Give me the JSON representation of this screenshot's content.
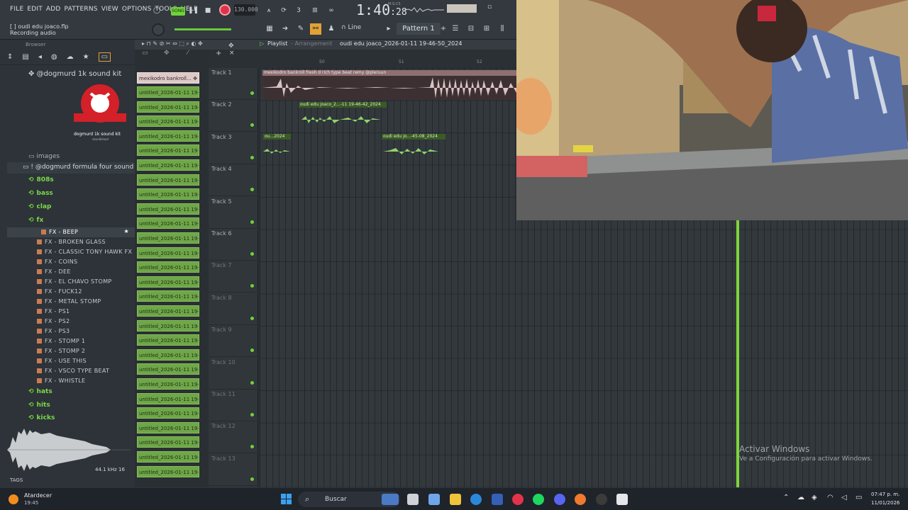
{
  "menu": [
    "FILE",
    "EDIT",
    "ADD",
    "PATTERNS",
    "VIEW",
    "OPTIONS",
    "TOOLS",
    "HELP"
  ],
  "transport": {
    "mode": "SONG",
    "tempo": "130.000",
    "time_main": "1:40",
    "time_sub": ":28",
    "time_label": "M:S:CS"
  },
  "hint_bar": {
    "file": "[ ] oudi edu joaco.flp",
    "status": "Recording audio"
  },
  "snap": "Line",
  "pattern": "Pattern 1",
  "browser": {
    "header": "Browser",
    "pack_title": "@dogmurd 1k sound kit",
    "logo_caption": "dogmurd 1k sound kit",
    "logo_sub": "soundcloud",
    "images": "images",
    "pack2": "! @dogmurd formula four sound kit",
    "folders_top": [
      "808s",
      "bass",
      "clap",
      "fx"
    ],
    "fx_selected": "FX - BEEP",
    "fx_items": [
      "FX - BROKEN GLASS",
      "FX - CLASSIC TONY HAWK FX",
      "FX - COINS",
      "FX - DEE",
      "FX - EL CHAVO STOMP",
      "FX - FUCK12",
      "FX - METAL STOMP",
      "FX - PS1",
      "FX - PS2",
      "FX - PS3",
      "FX - STOMP 1",
      "FX - STOMP 2",
      "FX - USE THIS",
      "FX - VSCO TYPE BEAT",
      "FX - WHISTLE"
    ],
    "folders_bottom": [
      "hats",
      "hits",
      "kicks"
    ],
    "sample_rate": "44.1 kHz 16",
    "tags": "TAGS"
  },
  "playlist": {
    "title": "Playlist",
    "mode": "Arrangement",
    "arrangement": "oudi edu joaco_2026-01-11 19-46-50_2024",
    "bar_numbers": [
      "50",
      "51",
      "52"
    ],
    "tracks": [
      "Track 1",
      "Track 2",
      "Track 3",
      "Track 4",
      "Track 5",
      "Track 6",
      "Track 7",
      "Track 8",
      "Track 9",
      "Track 10",
      "Track 11",
      "Track 12",
      "Track 13"
    ],
    "clips": {
      "t1": "mexikodro  bankroll fresh  d rich type beat remy @pleruun",
      "t2": "oudi edu joaco_2...-11 19-46-42_2024",
      "t3a": "ou...2024",
      "t3b": "oudi edu jo...-45-08_2024"
    }
  },
  "clip_list": {
    "first": "mexikodro  bankroll...",
    "items": [
      "untitled_2026-01-11 19-...",
      "untitled_2026-01-11 19-...",
      "untitled_2026-01-11 19-...",
      "untitled_2026-01-11 19-...",
      "untitled_2026-01-11 19-...",
      "untitled_2026-01-11 19-...",
      "untitled_2026-01-11 19-...",
      "untitled_2026-01-11 19-...",
      "untitled_2026-01-11 19-...",
      "untitled_2026-01-11 19-...",
      "untitled_2026-01-11 19-...",
      "untitled_2026-01-11 19-...",
      "untitled_2026-01-11 19-...",
      "untitled_2026-01-11 19-...",
      "untitled_2026-01-11 19-...",
      "untitled_2026-01-11 19-...",
      "untitled_2026-01-11 19-...",
      "untitled_2026-01-11 19-...",
      "untitled_2026-01-11 19-...",
      "untitled_2026-01-11 19-...",
      "untitled_2026-01-11 19-...",
      "untitled_2026-01-11 19-...",
      "untitled_2026-01-11 19-...",
      "untitled_2026-01-11 19-...",
      "untitled_2026-01-11 19-...",
      "untitled_2026-01-11 19-...",
      "untitled_2026-01-11 19-..."
    ]
  },
  "watermark": {
    "line1": "Activar Windows",
    "line2": "Ve a Configuración para activar Windows."
  },
  "taskbar": {
    "weather_title": "Atardecer",
    "weather_time": "19:45",
    "search": "Buscar",
    "clock_time": "07:47 p. m.",
    "clock_date": "11/01/2026"
  },
  "colors": {
    "accent_green": "#6fd33a",
    "record_red": "#e0334a",
    "clip_green": "#6ea648",
    "clip_pink": "#ddc9c8"
  }
}
